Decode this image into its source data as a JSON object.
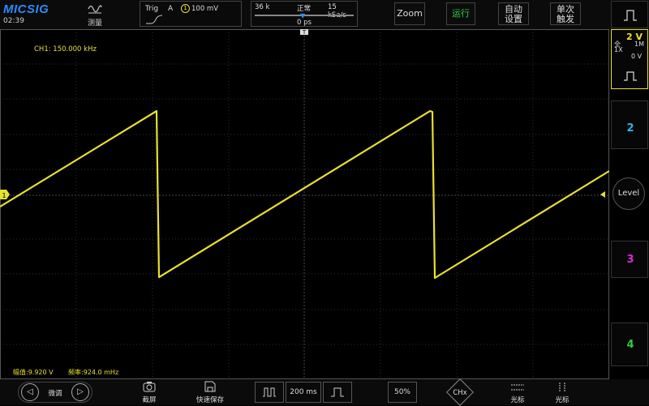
{
  "header": {
    "brand": "MICSIG",
    "clock": "02:39",
    "measure_label": "测量",
    "trigger": {
      "title": "Trig",
      "source": "A",
      "channel": "1",
      "level": "100 mV"
    },
    "timebase": {
      "memory": "36 k",
      "mode": "正常",
      "sample_rate": "15 kSa/s",
      "delay": "0 ps"
    },
    "buttons": {
      "zoom": "Zoom",
      "run": "运行",
      "auto_line1": "自动",
      "auto_line2": "设置",
      "single_line1": "单次",
      "single_line2": "触发"
    }
  },
  "screen": {
    "channel_info": "CH1: 150.000 kHz",
    "ch1_marker": "1"
  },
  "right_panel": {
    "ch1": {
      "volts": "2 V",
      "full": "全",
      "probe": "1X",
      "impedance": "1M",
      "offset": "0 V",
      "color": "#e8e030"
    },
    "ch2": {
      "label": "2",
      "color": "#2fb6e8"
    },
    "ch3": {
      "label": "3",
      "color": "#d92bd9"
    },
    "ch4": {
      "label": "4",
      "color": "#2ecc40"
    },
    "level": "Level"
  },
  "measurements": {
    "amplitude": "幅值:9.920 V",
    "frequency": "频率:924.0 mHz"
  },
  "footer": {
    "fine_tune": "微调",
    "screenshot": "截屏",
    "quick_save": "快速保存",
    "time_div": "200 ms",
    "percent": "50%",
    "chx": "CHx",
    "cursor1": "光标",
    "cursor2": "光标"
  },
  "colors": {
    "trace": "#e8e030",
    "accent": "#2a8cff",
    "grid": "#3a3a3a"
  }
}
